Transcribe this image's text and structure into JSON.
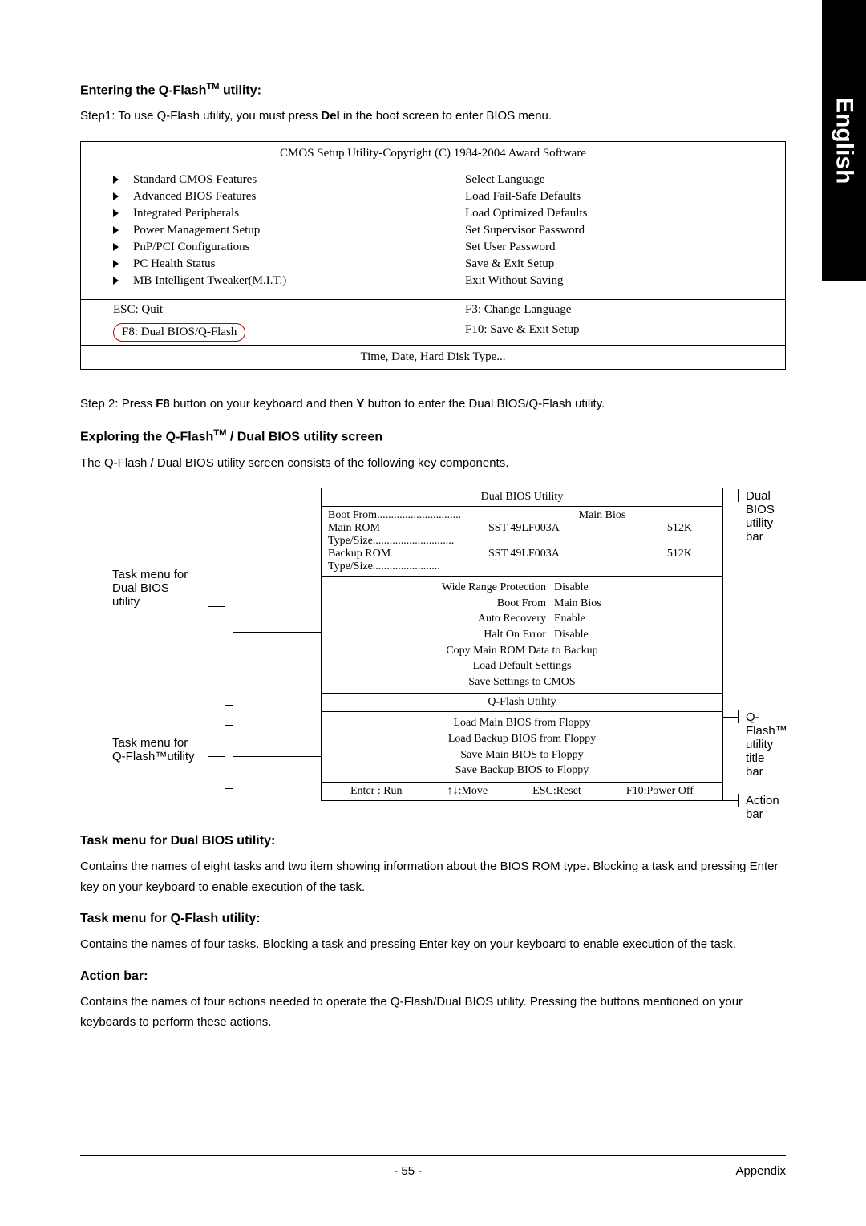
{
  "side_label": "English",
  "h1": "Entering the Q-Flash",
  "h1_tm": "TM",
  "h1_tail": " utility:",
  "step1_a": "Step1: To use Q-Flash utility, you must press ",
  "step1_b": "Del",
  "step1_c": " in the boot screen to enter BIOS menu.",
  "bios": {
    "title": "CMOS Setup Utility-Copyright (C) 1984-2004 Award Software",
    "left": [
      "Standard CMOS Features",
      "Advanced BIOS Features",
      "Integrated Peripherals",
      "Power Management Setup",
      "PnP/PCI Configurations",
      "PC Health Status",
      "MB Intelligent Tweaker(M.I.T.)"
    ],
    "right": [
      "Select Language",
      "Load Fail-Safe Defaults",
      "Load Optimized Defaults",
      "Set Supervisor Password",
      "Set User Password",
      "Save & Exit Setup",
      "Exit Without Saving"
    ],
    "key_esc": "ESC: Quit",
    "key_f3": "F3: Change Language",
    "key_f8": "F8: Dual BIOS/Q-Flash",
    "key_f10": "F10: Save & Exit Setup",
    "bottom": "Time, Date, Hard Disk Type..."
  },
  "step2_a": "Step 2: Press ",
  "step2_b": "F8",
  "step2_c": " button on your keyboard and then ",
  "step2_d": "Y",
  "step2_e": " button to enter the Dual BIOS/Q-Flash utility.",
  "h2": "Exploring the Q-Flash",
  "h2_tm": "TM",
  "h2_tail": " / Dual BIOS utility screen",
  "p2": "The Q-Flash / Dual BIOS utility screen consists of the following key components.",
  "util": {
    "title": "Dual BIOS Utility",
    "boot_from_label": "Boot From..............................",
    "boot_from_value": "Main Bios",
    "main_rom_label": "Main ROM Type/Size.............................",
    "main_rom_value": "SST 49LF003A",
    "main_rom_size": "512K",
    "backup_rom_label": "Backup ROM Type/Size........................",
    "backup_rom_value": "SST 49LF003A",
    "backup_rom_size": "512K",
    "opts": [
      {
        "lbl": "Wide Range Protection",
        "val": "Disable"
      },
      {
        "lbl": "Boot From",
        "val": "Main Bios"
      },
      {
        "lbl": "Auto Recovery",
        "val": "Enable"
      },
      {
        "lbl": "Halt On Error",
        "val": "Disable"
      }
    ],
    "lines_a": [
      "Copy Main ROM Data to Backup",
      "Load Default Settings",
      "Save Settings to CMOS"
    ],
    "qflash_title": "Q-Flash Utility",
    "lines_b": [
      "Load Main BIOS from Floppy",
      "Load Backup BIOS from Floppy",
      "Save Main BIOS to Floppy",
      "Save Backup BIOS to Floppy"
    ],
    "act_enter": "Enter : Run",
    "act_move": "↑↓:Move",
    "act_esc": "ESC:Reset",
    "act_f10": "F10:Power Off"
  },
  "anno": {
    "task_dual_a": "Task menu for",
    "task_dual_b": "Dual BIOS",
    "task_dual_c": "utility",
    "task_qf_a": "Task menu for",
    "task_qf_b": "Q-Flash™utility",
    "dual_bar": "Dual BIOS utility bar",
    "qf_title_a": "Q-Flash™ utility title",
    "qf_title_b": "bar",
    "action_bar": "Action bar"
  },
  "h3": "Task menu for Dual BIOS utility:",
  "p3": "Contains the names of eight tasks and two item showing information about the BIOS ROM type. Blocking a task and pressing Enter key on your keyboard to enable execution of the task.",
  "h4": "Task menu for Q-Flash utility:",
  "p4": "Contains the names of four tasks. Blocking a task and pressing Enter key on your keyboard to enable execution of the task.",
  "h5": "Action bar:",
  "p5": "Contains the names of four actions needed to operate the Q-Flash/Dual BIOS utility. Pressing the buttons mentioned on your keyboards to perform these actions.",
  "page_no": "- 55 -",
  "appendix": "Appendix"
}
